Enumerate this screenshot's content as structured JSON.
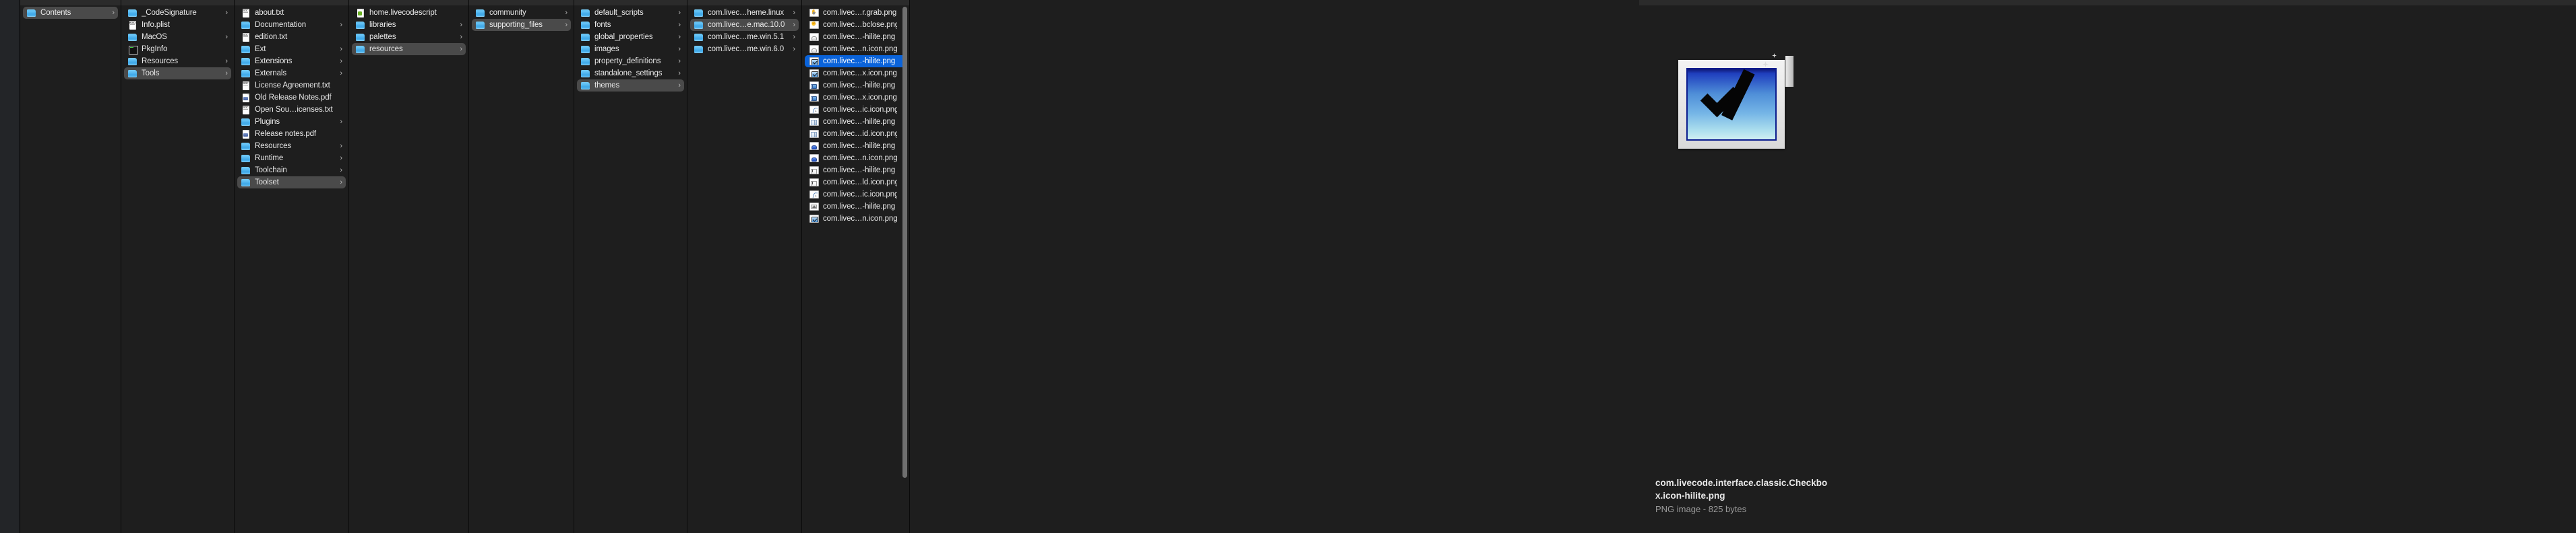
{
  "window": {
    "title": "Finder",
    "view_mode": "column"
  },
  "sidebar": {
    "visible": true
  },
  "columns": [
    {
      "name": "column-contents",
      "items": [
        {
          "label": "Contents",
          "icon": "folder-icon",
          "kind": "folder",
          "chevron": "›",
          "state": "selected-inactive"
        }
      ]
    },
    {
      "name": "column-bundle-contents",
      "items": [
        {
          "label": "_CodeSignature",
          "icon": "folder-icon",
          "kind": "folder",
          "chevron": "›",
          "state": "normal"
        },
        {
          "label": "Info.plist",
          "icon": "plist-document-icon",
          "kind": "file",
          "chevron": "",
          "state": "normal"
        },
        {
          "label": "MacOS",
          "icon": "folder-icon",
          "kind": "folder",
          "chevron": "›",
          "state": "normal"
        },
        {
          "label": "PkgInfo",
          "icon": "terminal-document-icon",
          "kind": "file",
          "chevron": "",
          "state": "normal"
        },
        {
          "label": "Resources",
          "icon": "folder-icon",
          "kind": "folder",
          "chevron": "›",
          "state": "normal"
        },
        {
          "label": "Tools",
          "icon": "folder-icon",
          "kind": "folder",
          "chevron": "›",
          "state": "selected-inactive"
        }
      ]
    },
    {
      "name": "column-tools",
      "items": [
        {
          "label": "about.txt",
          "icon": "text-document-icon",
          "kind": "file",
          "chevron": "",
          "state": "normal"
        },
        {
          "label": "Documentation",
          "icon": "folder-icon",
          "kind": "folder",
          "chevron": "›",
          "state": "normal"
        },
        {
          "label": "edition.txt",
          "icon": "text-document-icon",
          "kind": "file",
          "chevron": "",
          "state": "normal"
        },
        {
          "label": "Ext",
          "icon": "folder-icon",
          "kind": "folder",
          "chevron": "›",
          "state": "normal"
        },
        {
          "label": "Extensions",
          "icon": "folder-icon",
          "kind": "folder",
          "chevron": "›",
          "state": "normal"
        },
        {
          "label": "Externals",
          "icon": "folder-icon",
          "kind": "folder",
          "chevron": "›",
          "state": "normal"
        },
        {
          "label": "License Agreement.txt",
          "icon": "text-document-icon",
          "kind": "file",
          "chevron": "",
          "state": "normal"
        },
        {
          "label": "Old Release Notes.pdf",
          "icon": "pdf-document-icon",
          "kind": "file",
          "chevron": "",
          "state": "normal"
        },
        {
          "label": "Open Sou…icenses.txt",
          "icon": "text-document-icon",
          "kind": "file",
          "chevron": "",
          "state": "normal"
        },
        {
          "label": "Plugins",
          "icon": "folder-icon",
          "kind": "folder",
          "chevron": "›",
          "state": "normal"
        },
        {
          "label": "Release notes.pdf",
          "icon": "pdf-document-icon",
          "kind": "file",
          "chevron": "",
          "state": "normal"
        },
        {
          "label": "Resources",
          "icon": "folder-icon",
          "kind": "folder",
          "chevron": "›",
          "state": "normal"
        },
        {
          "label": "Runtime",
          "icon": "folder-icon",
          "kind": "folder",
          "chevron": "›",
          "state": "normal"
        },
        {
          "label": "Toolchain",
          "icon": "folder-icon",
          "kind": "folder",
          "chevron": "›",
          "state": "normal"
        },
        {
          "label": "Toolset",
          "icon": "folder-icon",
          "kind": "folder",
          "chevron": "›",
          "state": "selected-inactive"
        }
      ]
    },
    {
      "name": "column-toolset",
      "items": [
        {
          "label": "home.livecodescript",
          "icon": "livecode-script-icon",
          "kind": "file",
          "chevron": "",
          "state": "normal"
        },
        {
          "label": "libraries",
          "icon": "folder-icon",
          "kind": "folder",
          "chevron": "›",
          "state": "normal"
        },
        {
          "label": "palettes",
          "icon": "folder-icon",
          "kind": "folder",
          "chevron": "›",
          "state": "normal"
        },
        {
          "label": "resources",
          "icon": "folder-icon",
          "kind": "folder",
          "chevron": "›",
          "state": "selected-inactive"
        }
      ]
    },
    {
      "name": "column-resources",
      "items": [
        {
          "label": "community",
          "icon": "folder-icon",
          "kind": "folder",
          "chevron": "›",
          "state": "normal"
        },
        {
          "label": "supporting_files",
          "icon": "folder-icon",
          "kind": "folder",
          "chevron": "›",
          "state": "selected-inactive"
        }
      ]
    },
    {
      "name": "column-supporting-files",
      "items": [
        {
          "label": "default_scripts",
          "icon": "folder-icon",
          "kind": "folder",
          "chevron": "›",
          "state": "normal"
        },
        {
          "label": "fonts",
          "icon": "folder-icon",
          "kind": "folder",
          "chevron": "›",
          "state": "normal"
        },
        {
          "label": "global_properties",
          "icon": "folder-icon",
          "kind": "folder",
          "chevron": "›",
          "state": "normal"
        },
        {
          "label": "images",
          "icon": "folder-icon",
          "kind": "folder",
          "chevron": "›",
          "state": "normal"
        },
        {
          "label": "property_definitions",
          "icon": "folder-icon",
          "kind": "folder",
          "chevron": "›",
          "state": "normal"
        },
        {
          "label": "standalone_settings",
          "icon": "folder-icon",
          "kind": "folder",
          "chevron": "›",
          "state": "normal"
        },
        {
          "label": "themes",
          "icon": "folder-icon",
          "kind": "folder",
          "chevron": "›",
          "state": "selected-inactive"
        }
      ]
    },
    {
      "name": "column-themes",
      "items": [
        {
          "label": "com.livec…heme.linux",
          "icon": "folder-icon",
          "kind": "folder",
          "chevron": "›",
          "state": "normal"
        },
        {
          "label": "com.livec…e.mac.10.0",
          "icon": "folder-icon",
          "kind": "folder",
          "chevron": "›",
          "state": "selected-inactive"
        },
        {
          "label": "com.livec…me.win.5.1",
          "icon": "folder-icon",
          "kind": "folder",
          "chevron": "›",
          "state": "normal"
        },
        {
          "label": "com.livec…me.win.6.0",
          "icon": "folder-icon",
          "kind": "folder",
          "chevron": "›",
          "state": "normal"
        }
      ]
    },
    {
      "name": "column-theme-files",
      "scrollbar": true,
      "items": [
        {
          "label": "com.livec…r.grab.png",
          "icon": "png-hand-open-icon",
          "kind": "png",
          "chevron": "",
          "state": "normal"
        },
        {
          "label": "com.livec…bclose.png",
          "icon": "png-hand-closed-icon",
          "kind": "png",
          "chevron": "",
          "state": "normal"
        },
        {
          "label": "com.livec…-hilite.png",
          "icon": "png-pill-button-icon",
          "kind": "png",
          "chevron": "",
          "state": "normal"
        },
        {
          "label": "com.livec…n.icon.png",
          "icon": "png-pill-button-icon",
          "kind": "png",
          "chevron": "",
          "state": "normal"
        },
        {
          "label": "com.livec…-hilite.png",
          "icon": "png-checkbox-icon",
          "kind": "png",
          "chevron": "",
          "state": "selected-active"
        },
        {
          "label": "com.livec…x.icon.png",
          "icon": "png-checkbox-icon",
          "kind": "png",
          "chevron": "",
          "state": "normal"
        },
        {
          "label": "com.livec…-hilite.png",
          "icon": "png-radio-pair-icon",
          "kind": "png",
          "chevron": "",
          "state": "normal"
        },
        {
          "label": "com.livec…x.icon.png",
          "icon": "png-radio-pair-icon",
          "kind": "png",
          "chevron": "",
          "state": "normal"
        },
        {
          "label": "com.livec…ic.icon.png",
          "icon": "png-curve-icon",
          "kind": "png",
          "chevron": "",
          "state": "normal"
        },
        {
          "label": "com.livec…-hilite.png",
          "icon": "png-scrollbar-icon",
          "kind": "png",
          "chevron": "",
          "state": "normal"
        },
        {
          "label": "com.livec…id.icon.png",
          "icon": "png-scrollbar-icon",
          "kind": "png",
          "chevron": "",
          "state": "normal"
        },
        {
          "label": "com.livec…-hilite.png",
          "icon": "png-pill-blue-icon",
          "kind": "png",
          "chevron": "",
          "state": "normal"
        },
        {
          "label": "com.livec…n.icon.png",
          "icon": "png-pill-blue-icon",
          "kind": "png",
          "chevron": "",
          "state": "normal"
        },
        {
          "label": "com.livec…-hilite.png",
          "icon": "png-text-field-icon",
          "kind": "png",
          "chevron": "",
          "state": "normal"
        },
        {
          "label": "com.livec…ld.icon.png",
          "icon": "png-text-field-icon",
          "kind": "png",
          "chevron": "",
          "state": "normal"
        },
        {
          "label": "com.livec…ic.icon.png",
          "icon": "png-curve-icon",
          "kind": "png",
          "chevron": "",
          "state": "normal"
        },
        {
          "label": "com.livec…-hilite.png",
          "icon": "png-image-icon",
          "kind": "png",
          "chevron": "",
          "state": "normal"
        },
        {
          "label": "com.livec…n.icon.png",
          "icon": "png-checkbox-icon",
          "kind": "png",
          "chevron": "",
          "state": "normal"
        }
      ]
    }
  ],
  "preview": {
    "artwork": "checkbox-hilite-thumbnail",
    "filename": "com.livecode.interface.classic.Checkbox.icon-hilite.png",
    "kind_and_size": "PNG image - 825 bytes"
  },
  "colors": {
    "window_background": "#1e1e1e",
    "sidebar_background": "#232528",
    "selection_active": "#0a63da",
    "selection_inactive": "#4a4a4a",
    "text_primary": "#e9e9e9",
    "text_secondary": "#9a9a9a",
    "folder_blue": "#4ab4ef"
  }
}
